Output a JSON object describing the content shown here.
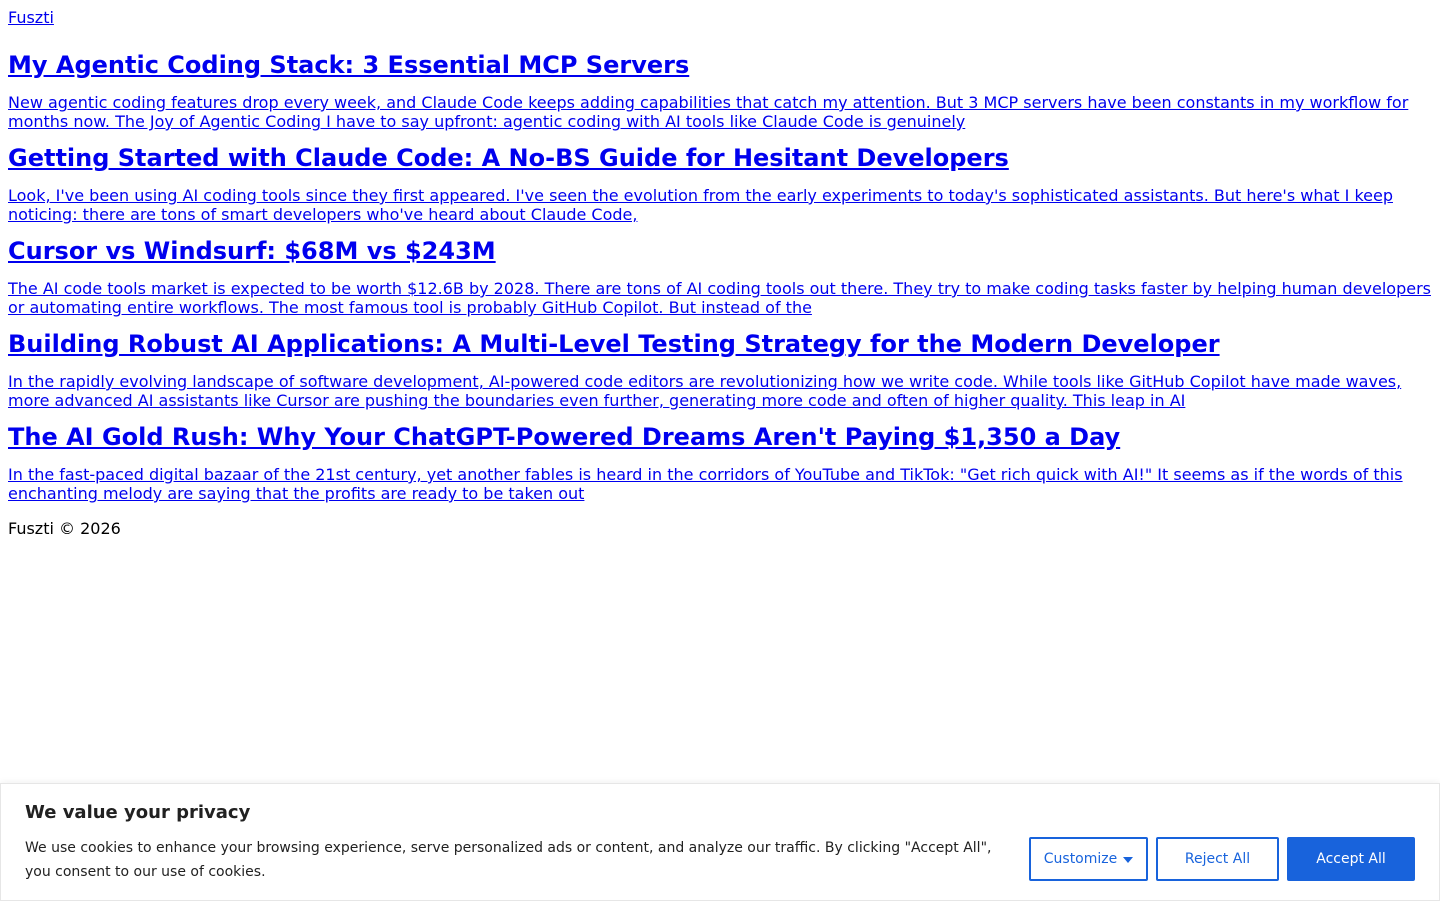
{
  "site": {
    "name": "Fuszti"
  },
  "posts": [
    {
      "title": "My Agentic Coding Stack: 3 Essential MCP Servers",
      "excerpt": "New agentic coding features drop every week, and Claude Code keeps adding capabilities that catch my attention. But 3 MCP servers have been constants in my workflow for months now. The Joy of Agentic Coding I have to say upfront: agentic coding with AI tools like Claude Code is genuinely"
    },
    {
      "title": "Getting Started with Claude Code: A No-BS Guide for Hesitant Developers",
      "excerpt": "Look, I've been using AI coding tools since they first appeared. I've seen the evolution from the early experiments to today's sophisticated assistants. But here's what I keep noticing: there are tons of smart developers who've heard about Claude Code,"
    },
    {
      "title": "Cursor vs Windsurf: $68M vs $243M",
      "excerpt": "The AI code tools market is expected to be worth $12.6B by 2028. There are tons of AI coding tools out there. They try to make coding tasks faster by helping human developers or automating entire workflows. The most famous tool is probably GitHub Copilot. But instead of the"
    },
    {
      "title": "Building Robust AI Applications: A Multi-Level Testing Strategy for the Modern Developer",
      "excerpt": "In the rapidly evolving landscape of software development, AI-powered code editors are revolutionizing how we write code. While tools like GitHub Copilot have made waves, more advanced AI assistants like Cursor are pushing the boundaries even further, generating more code and often of higher quality. This leap in AI"
    },
    {
      "title": "The AI Gold Rush: Why Your ChatGPT-Powered Dreams Aren't Paying $1,350 a Day",
      "excerpt": "In the fast-paced digital bazaar of the 21st century, yet another fables is heard in the corridors of YouTube and TikTok: \"Get rich quick with AI!\" It seems as if the words of this enchanting melody are saying that the profits are ready to be taken out"
    }
  ],
  "footer": {
    "text": "Fuszti © 2026"
  },
  "cookie_banner": {
    "title": "We value your privacy",
    "text": "We use cookies to enhance your browsing experience, serve personalized ads or content, and analyze our traffic. By clicking \"Accept All\", you consent to our use of cookies.",
    "customize_label": "Customize",
    "reject_label": "Reject All",
    "accept_label": "Accept All",
    "accent_color": "#1863dc"
  }
}
